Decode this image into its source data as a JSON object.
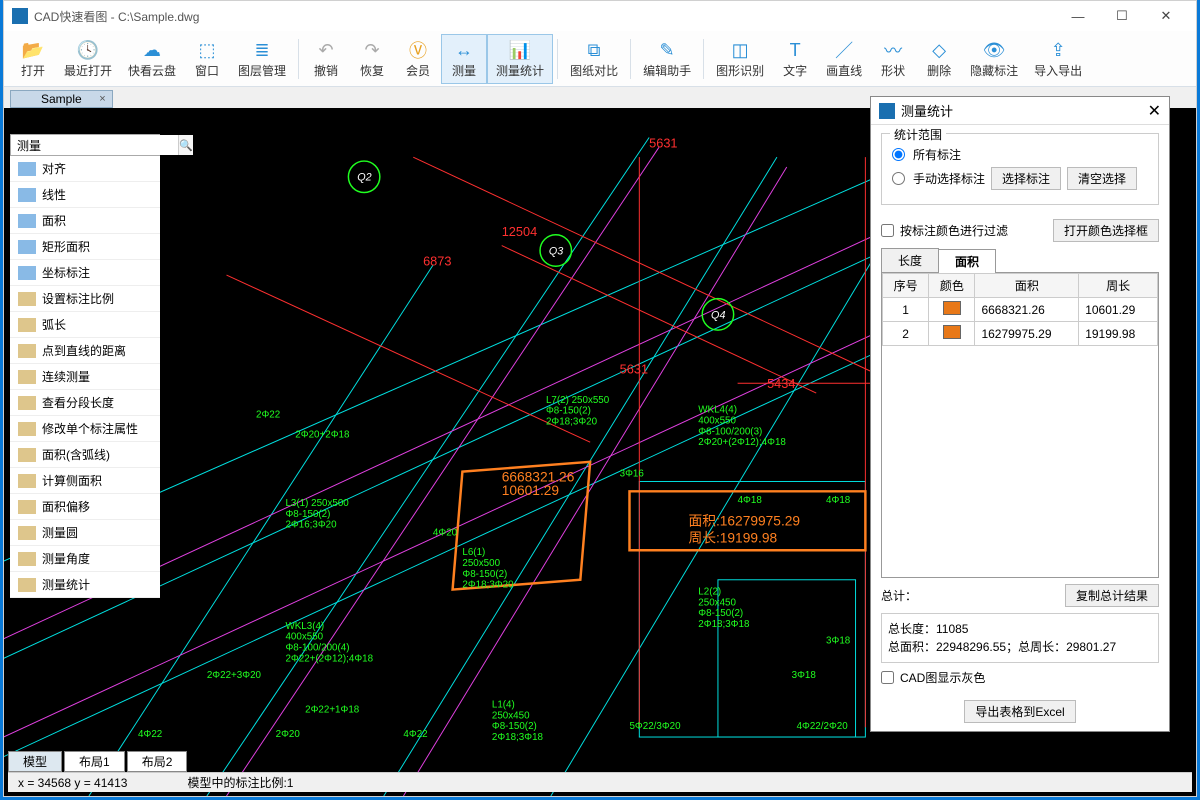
{
  "app": {
    "title": "CAD快速看图 - C:\\Sample.dwg"
  },
  "toolbar": [
    {
      "id": "open",
      "label": "打开",
      "color": "#2b8fd6"
    },
    {
      "id": "recent",
      "label": "最近打开",
      "color": "#2b8fd6"
    },
    {
      "id": "cloud",
      "label": "快看云盘",
      "color": "#2b8fd6"
    },
    {
      "id": "window",
      "label": "窗口",
      "color": "#2b8fd6"
    },
    {
      "id": "layers",
      "label": "图层管理",
      "color": "#2b8fd6"
    },
    {
      "sep": true
    },
    {
      "id": "undo",
      "label": "撤销",
      "color": "#aaa"
    },
    {
      "id": "redo",
      "label": "恢复",
      "color": "#aaa"
    },
    {
      "id": "vip",
      "label": "会员",
      "color": "#e8a020"
    },
    {
      "id": "measure",
      "label": "测量",
      "color": "#2b8fd6",
      "active": true
    },
    {
      "id": "measure-stats",
      "label": "测量统计",
      "color": "#2b8fd6",
      "active": true
    },
    {
      "sep": true
    },
    {
      "id": "compare",
      "label": "图纸对比",
      "color": "#2b8fd6"
    },
    {
      "sep": true
    },
    {
      "id": "editor",
      "label": "编辑助手",
      "color": "#2b8fd6"
    },
    {
      "sep": true
    },
    {
      "id": "recognize",
      "label": "图形识别",
      "color": "#2b8fd6"
    },
    {
      "id": "text",
      "label": "文字",
      "color": "#2b8fd6"
    },
    {
      "id": "line",
      "label": "画直线",
      "color": "#2b8fd6"
    },
    {
      "id": "shape",
      "label": "形状",
      "color": "#2b8fd6"
    },
    {
      "id": "delete",
      "label": "删除",
      "color": "#2b8fd6"
    },
    {
      "id": "hide-annot",
      "label": "隐藏标注",
      "color": "#2b8fd6"
    },
    {
      "id": "import-export",
      "label": "导入导出",
      "color": "#2b8fd6"
    }
  ],
  "file_tab": {
    "name": "Sample"
  },
  "sidebar": {
    "search_placeholder": "测量",
    "items": [
      {
        "label": "对齐",
        "color": "#3a8cd6"
      },
      {
        "label": "线性",
        "color": "#3a8cd6"
      },
      {
        "label": "面积",
        "color": "#3a8cd6"
      },
      {
        "label": "矩形面积",
        "color": "#3a8cd6"
      },
      {
        "label": "坐标标注",
        "color": "#3a8cd6"
      },
      {
        "label": "设置标注比例",
        "color": "#c8a040"
      },
      {
        "label": "弧长",
        "color": "#c8a040"
      },
      {
        "label": "点到直线的距离",
        "color": "#c8a040"
      },
      {
        "label": "连续测量",
        "color": "#c8a040"
      },
      {
        "label": "查看分段长度",
        "color": "#c8a040"
      },
      {
        "label": "修改单个标注属性",
        "color": "#c8a040"
      },
      {
        "label": "面积(含弧线)",
        "color": "#c8a040"
      },
      {
        "label": "计算侧面积",
        "color": "#c8a040"
      },
      {
        "label": "面积偏移",
        "color": "#c8a040"
      },
      {
        "label": "测量圆",
        "color": "#c8a040"
      },
      {
        "label": "测量角度",
        "color": "#c8a040"
      },
      {
        "label": "测量统计",
        "color": "#c8a040"
      }
    ]
  },
  "layout_tabs": [
    "模型",
    "布局1",
    "布局2"
  ],
  "statusbar": {
    "coords": "x = 34568 y = 41413",
    "scale": "模型中的标注比例:1"
  },
  "panel": {
    "title": "测量统计",
    "scope_legend": "统计范围",
    "radio_all": "所有标注",
    "radio_manual": "手动选择标注",
    "btn_select": "选择标注",
    "btn_clear": "清空选择",
    "check_color_filter": "按标注颜色进行过滤",
    "btn_color_pick": "打开颜色选择框",
    "tab_length": "长度",
    "tab_area": "面积",
    "table": {
      "cols": [
        "序号",
        "颜色",
        "面积",
        "周长"
      ],
      "rows": [
        {
          "idx": "1",
          "color": "#e87818",
          "area": "6668321.26",
          "peri": "10601.29"
        },
        {
          "idx": "2",
          "color": "#e87818",
          "area": "16279975.29",
          "peri": "19199.98"
        }
      ]
    },
    "total_label": "总计：",
    "btn_copy": "复制总计结果",
    "total_text1": "总长度：11085",
    "total_text2": "总面积：22948296.55；总周长：29801.27",
    "check_gray": "CAD图显示灰色",
    "btn_export": "导出表格到Excel"
  },
  "canvas_labels": {
    "dim1": "5631",
    "dim2": "6873",
    "dim3": "12504",
    "dim4": "5631",
    "dim5": "5434",
    "area1a": "6668321.26",
    "area1b": "10601.29",
    "area2a": "面积:16279975.29",
    "area2b": "周长:19199.98",
    "t1": "WKL4(4)",
    "t1b": "400x550",
    "t1c": "Φ8-100/200(3)",
    "t1d": "2Φ20+(2Φ12);4Φ18",
    "t2": "L7(2) 250x550",
    "t2b": "Φ8-150(2)",
    "t2c": "2Φ18;3Φ20",
    "t3": "L3(1) 250x500",
    "t3b": "Φ8-150(2)",
    "t3c": "2Φ16;3Φ20",
    "t4": "L6(1)",
    "t4b": "250x500",
    "t4c": "Φ8-150(2)",
    "t4d": "2Φ18;3Φ20",
    "t5": "WKL3(4)",
    "t5b": "400x550",
    "t5c": "Φ8-100/200(4)",
    "t5d": "2Φ22+(2Φ12);4Φ18",
    "t6": "L2(2)",
    "t6b": "250x450",
    "t6c": "Φ8-150(2)",
    "t6d": "2Φ18;3Φ18",
    "t7": "L1(4)",
    "t7b": "250x450",
    "t7c": "Φ8-150(2)",
    "t7d": "2Φ18;3Φ18",
    "r1": "4Φ18",
    "r2": "4Φ18",
    "r3": "3Φ16",
    "r4": "2Φ22",
    "r5": "4Φ20",
    "r6": "4Φ22",
    "r7": "2Φ20+2Φ18",
    "r8": "2Φ22+3Φ20",
    "r9": "2Φ22+1Φ18",
    "r10": "3Φ18",
    "r11": "3Φ18",
    "r12": "4Φ22/2Φ20",
    "r13": "5Φ22/3Φ20",
    "r14": "2Φ20",
    "r15": "4Φ22",
    "c1": "Q2",
    "c2": "Q3",
    "c3": "Q4"
  }
}
